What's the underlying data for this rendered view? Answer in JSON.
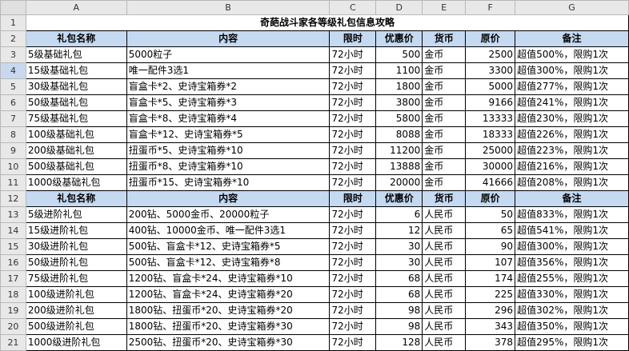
{
  "columns": [
    "A",
    "B",
    "C",
    "D",
    "E",
    "F",
    "G"
  ],
  "title": "奇葩战斗家各等级礼包信息攻略",
  "headers": [
    "礼包名称",
    "内容",
    "限时",
    "优惠价",
    "货币",
    "原价",
    "备注"
  ],
  "basic_rows": [
    [
      "5级基础礼包",
      "5000粒子",
      "72小时",
      "500",
      "金币",
      "2500",
      "超值500%，限购1次"
    ],
    [
      "15级基础礼包",
      "唯一配件3选1",
      "72小时",
      "1100",
      "金币",
      "3300",
      "超值300%，限购1次"
    ],
    [
      "30级基础礼包",
      "盲盒卡*2、史诗宝箱券*2",
      "72小时",
      "1800",
      "金币",
      "5000",
      "超值277%，限购1次"
    ],
    [
      "50级基础礼包",
      "盲盒卡*5、史诗宝箱券*3",
      "72小时",
      "3800",
      "金币",
      "9166",
      "超值241%，限购1次"
    ],
    [
      "75级基础礼包",
      "盲盒卡*8、史诗宝箱券*4",
      "72小时",
      "5800",
      "金币",
      "13333",
      "超值230%，限购1次"
    ],
    [
      "100级基础礼包",
      "盲盒卡*12、史诗宝箱券*5",
      "72小时",
      "8088",
      "金币",
      "18333",
      "超值226%，限购1次"
    ],
    [
      "200级基础礼包",
      "扭蛋币*5、史诗宝箱券*10",
      "72小时",
      "11200",
      "金币",
      "25000",
      "超值223%，限购1次"
    ],
    [
      "500级基础礼包",
      "扭蛋币*8、史诗宝箱券*10",
      "72小时",
      "13888",
      "金币",
      "30000",
      "超值216%，限购1次"
    ],
    [
      "1000级基础礼包",
      "扭蛋币*15、史诗宝箱券*10",
      "72小时",
      "20000",
      "金币",
      "41666",
      "超值208%，限购1次"
    ]
  ],
  "advanced_rows": [
    [
      "5级进阶礼包",
      "200钻、5000金币、20000粒子",
      "72小时",
      "6",
      "人民币",
      "50",
      "超值833%，限购1次"
    ],
    [
      "15级进阶礼包",
      "400钻、10000金币、唯一配件3选1",
      "72小时",
      "12",
      "人民币",
      "65",
      "超值541%，限购1次"
    ],
    [
      "30级进阶礼包",
      "500钻、盲盒卡*12、史诗宝箱券*5",
      "72小时",
      "30",
      "人民币",
      "90",
      "超值300%，限购1次"
    ],
    [
      "50级进阶礼包",
      "500钻、盲盒卡*12、史诗宝箱券*8",
      "72小时",
      "30",
      "人民币",
      "107",
      "超值356%，限购1次"
    ],
    [
      "75级进阶礼包",
      "1200钻、盲盒卡*24、史诗宝箱券*10",
      "72小时",
      "68",
      "人民币",
      "174",
      "超值255%，限购1次"
    ],
    [
      "100级进阶礼包",
      "1200钻、盲盒卡*24、史诗宝箱券*20",
      "72小时",
      "68",
      "人民币",
      "225",
      "超值330%，限购1次"
    ],
    [
      "200级进阶礼包",
      "1800钻、扭蛋币*20、史诗宝箱券*20",
      "72小时",
      "98",
      "人民币",
      "296",
      "超值302%，限购1次"
    ],
    [
      "500级进阶礼包",
      "1800钻、扭蛋币*20、史诗宝箱券*30",
      "72小时",
      "98",
      "人民币",
      "343",
      "超值350%，限购1次"
    ],
    [
      "1000级进阶礼包",
      "2500钻、扭蛋币*20、史诗宝箱券*30",
      "72小时",
      "128",
      "人民币",
      "378",
      "超值295%，限购1次"
    ]
  ],
  "colors": {
    "header_fill": "#c5d9f1",
    "selected_row": "#c9d8ef"
  }
}
